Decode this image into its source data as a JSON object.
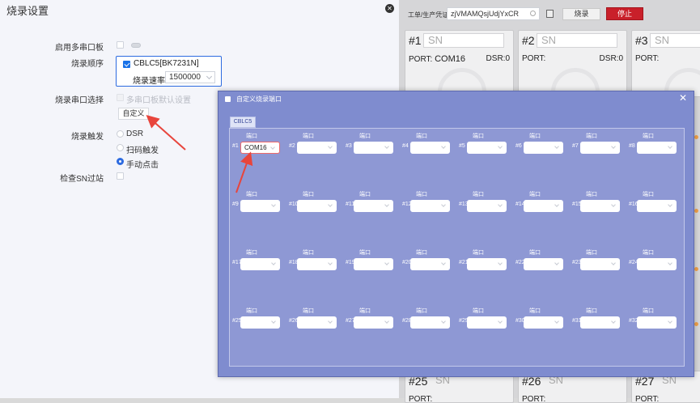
{
  "settings": {
    "title": "烧录设置",
    "multi_serial_label": "启用多串口板",
    "burn_order_label": "烧录顺序",
    "burn_order_item": "CBLC5[BK7231N]",
    "burn_rate_label": "烧录速率",
    "burn_rate_value": "1500000",
    "serial_select_label": "烧录串口选择",
    "multi_default_label": "多串口板默认设置",
    "custom_button": "自定义",
    "trigger_label": "烧录触发",
    "trigger_options": [
      "DSR",
      "扫码触发",
      "手动点击"
    ],
    "trigger_selected": "手动点击",
    "sn_filter_label": "检查SN过站"
  },
  "toolbar": {
    "workorder_label": "工单/生产凭证",
    "workorder_value": "zjVMAMQsjUdjYxCR",
    "burn_button": "烧录",
    "stop_button": "停止"
  },
  "cards": [
    {
      "num": "#1",
      "sn": "SN",
      "port": "PORT:",
      "port_value": "COM16",
      "dsr": "DSR:0"
    },
    {
      "num": "#2",
      "sn": "SN",
      "port": "PORT:",
      "port_value": "",
      "dsr": "DSR:0"
    },
    {
      "num": "#3",
      "sn": "SN",
      "port": "PORT:",
      "port_value": "",
      "dsr": ""
    },
    {
      "num": "#25",
      "sn": "SN",
      "port": "PORT:"
    },
    {
      "num": "#26",
      "sn": "SN",
      "port": "PORT:"
    },
    {
      "num": "#27",
      "sn": "SN",
      "port": "PORT:"
    }
  ],
  "modal": {
    "title": "自定义烧录端口",
    "tab": "CBLC5",
    "port_caption": "端口",
    "ports": [
      {
        "num": "#1",
        "value": "COM16"
      },
      {
        "num": "#2",
        "value": ""
      },
      {
        "num": "#3",
        "value": ""
      },
      {
        "num": "#4",
        "value": ""
      },
      {
        "num": "#5",
        "value": ""
      },
      {
        "num": "#6",
        "value": ""
      },
      {
        "num": "#7",
        "value": ""
      },
      {
        "num": "#8",
        "value": ""
      },
      {
        "num": "#9",
        "value": ""
      },
      {
        "num": "#10",
        "value": ""
      },
      {
        "num": "#11",
        "value": ""
      },
      {
        "num": "#12",
        "value": ""
      },
      {
        "num": "#13",
        "value": ""
      },
      {
        "num": "#14",
        "value": ""
      },
      {
        "num": "#15",
        "value": ""
      },
      {
        "num": "#16",
        "value": ""
      },
      {
        "num": "#17",
        "value": ""
      },
      {
        "num": "#18",
        "value": ""
      },
      {
        "num": "#19",
        "value": ""
      },
      {
        "num": "#20",
        "value": ""
      },
      {
        "num": "#21",
        "value": ""
      },
      {
        "num": "#22",
        "value": ""
      },
      {
        "num": "#23",
        "value": ""
      },
      {
        "num": "#24",
        "value": ""
      },
      {
        "num": "#25",
        "value": ""
      },
      {
        "num": "#26",
        "value": ""
      },
      {
        "num": "#27",
        "value": ""
      },
      {
        "num": "#28",
        "value": ""
      },
      {
        "num": "#29",
        "value": ""
      },
      {
        "num": "#30",
        "value": ""
      },
      {
        "num": "#31",
        "value": ""
      },
      {
        "num": "#32",
        "value": ""
      }
    ]
  },
  "colors": {
    "accent": "#2d6be0",
    "stop": "#c9202a",
    "modal_bg": "#7f8ccf",
    "annotation_arrow": "#e8453c"
  }
}
